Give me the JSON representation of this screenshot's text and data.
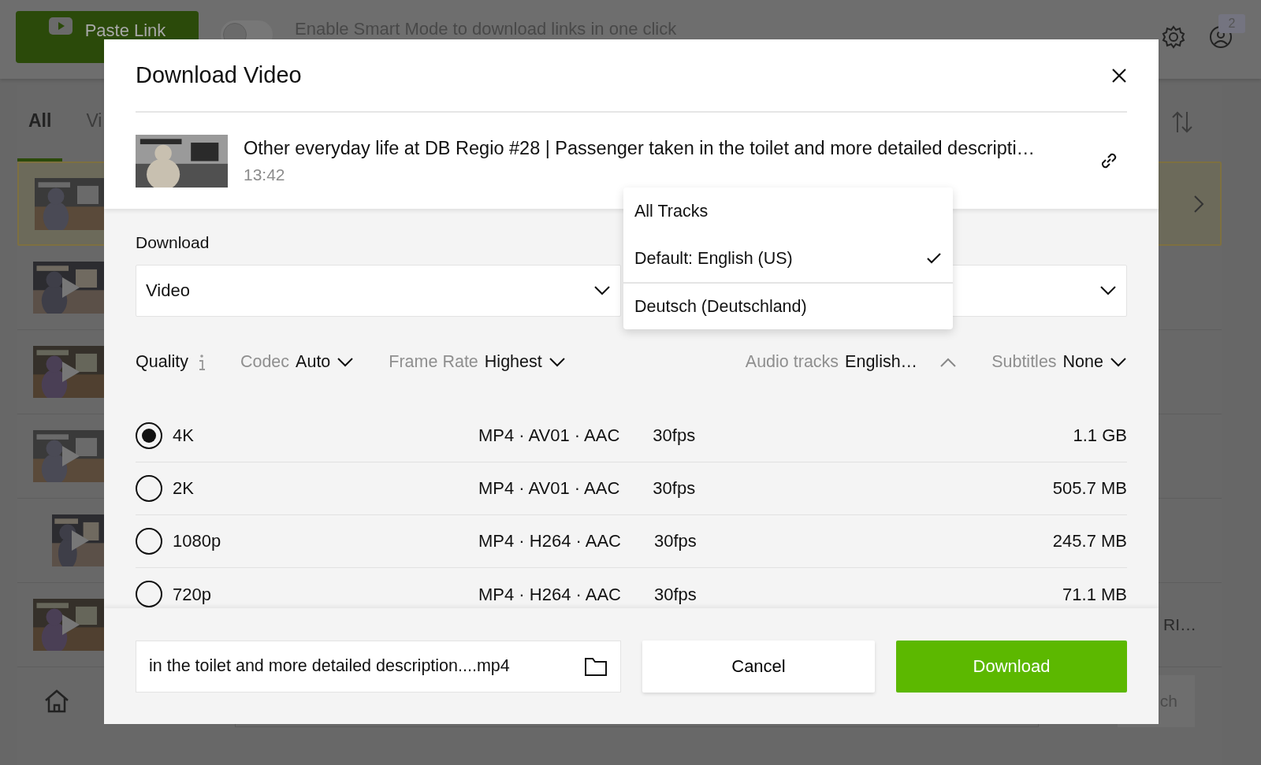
{
  "app": {
    "paste_button": "Paste Link",
    "smart_mode": {
      "on": false,
      "label": "Enable Smart Mode to download links in one click"
    },
    "notification_count": "2",
    "tabs": [
      {
        "label": "All",
        "selected": true
      },
      {
        "label": "Vi",
        "selected": false
      }
    ],
    "list_items": [
      {
        "selected": true,
        "kind": "wide",
        "playable": false
      },
      {
        "selected": false,
        "kind": "wide",
        "playable": true
      },
      {
        "selected": false,
        "kind": "wide",
        "playable": true
      },
      {
        "selected": false,
        "kind": "wide",
        "playable": true
      },
      {
        "selected": false,
        "kind": "portrait",
        "playable": true
      },
      {
        "selected": false,
        "kind": "wide",
        "playable": true,
        "snippet": "RI…"
      }
    ],
    "search_button": "ch"
  },
  "dialog": {
    "title": "Download Video",
    "video": {
      "title": "Other everyday life at DB Regio #28 | Passenger taken in the toilet and more detailed descripti…",
      "duration": "13:42"
    },
    "download_label": "Download",
    "type_select": {
      "value": "Video"
    },
    "track_menu": [
      {
        "label": "All Tracks",
        "selected": false
      },
      {
        "label": "Default: English (US)",
        "selected": true
      },
      {
        "label": "Deutsch (Deutschland)",
        "selected": false
      }
    ],
    "filters_left": [
      {
        "kind": "info",
        "label": "Quality"
      },
      {
        "kind": "select",
        "label": "Codec",
        "value": "Auto",
        "expanded": false
      },
      {
        "kind": "select",
        "label": "Frame Rate",
        "value": "Highest",
        "expanded": false
      }
    ],
    "filters_right": [
      {
        "kind": "select",
        "label": "Audio tracks",
        "value": "English…",
        "expanded": true
      },
      {
        "kind": "select",
        "label": "Subtitles",
        "value": "None",
        "expanded": false
      }
    ],
    "formats": [
      {
        "quality": "4K",
        "format": "MP4 · AV01 · AAC",
        "fps": "30fps",
        "size": "1.1 GB",
        "selected": true
      },
      {
        "quality": "2K",
        "format": "MP4 · AV01 · AAC",
        "fps": "30fps",
        "size": "505.7 MB",
        "selected": false
      },
      {
        "quality": "1080p",
        "format": "MP4 · H264 · AAC",
        "fps": "30fps",
        "size": "245.7 MB",
        "selected": false
      },
      {
        "quality": "720p",
        "format": "MP4 · H264 · AAC",
        "fps": "30fps",
        "size": "71.1 MB",
        "selected": false
      }
    ],
    "filename": "in the toilet and more detailed description....mp4",
    "cancel_button": "Cancel",
    "download_button": "Download"
  }
}
